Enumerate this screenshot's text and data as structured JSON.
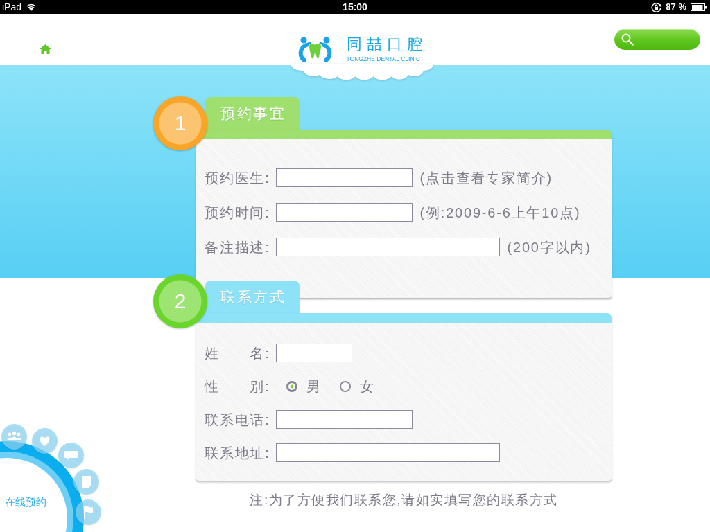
{
  "status_bar": {
    "device": "iPad",
    "time": "15:00",
    "battery": "87 %"
  },
  "header": {
    "brand": "同喆口腔",
    "brand_subtitle": "TONGZHE DENTAL CLINIC"
  },
  "sections": [
    {
      "badge": {
        "number": "1",
        "color": "#f9a527"
      },
      "tab": {
        "title": "预约事宜",
        "color": "#9fdf6e"
      },
      "fields": [
        {
          "kind": "medium",
          "label": "预约医生:",
          "hint": "(点击查看专家简介)"
        },
        {
          "kind": "medium",
          "label": "预约时间:",
          "hint": "(例:2009-6-6上午10点)"
        },
        {
          "kind": "long",
          "label": "备注描述:",
          "hint": "(200字以内)"
        }
      ]
    },
    {
      "badge": {
        "number": "2",
        "color": "#6ad62b"
      },
      "tab": {
        "title": "联系方式",
        "color": "#8de2f8"
      },
      "fields": [
        {
          "kind": "short",
          "label": "姓　　名:"
        },
        {
          "kind": "radio",
          "label": "性　　别:",
          "options": [
            {
              "label": "男",
              "selected": true
            },
            {
              "label": "女",
              "selected": false
            }
          ]
        },
        {
          "kind": "medium",
          "label": "联系电话:"
        },
        {
          "kind": "long",
          "label": "联系地址:"
        }
      ]
    }
  ],
  "note": "注:为了方便我们联系您,请如实填写您的联系方式",
  "quick_menu": {
    "label": "在线预约"
  }
}
